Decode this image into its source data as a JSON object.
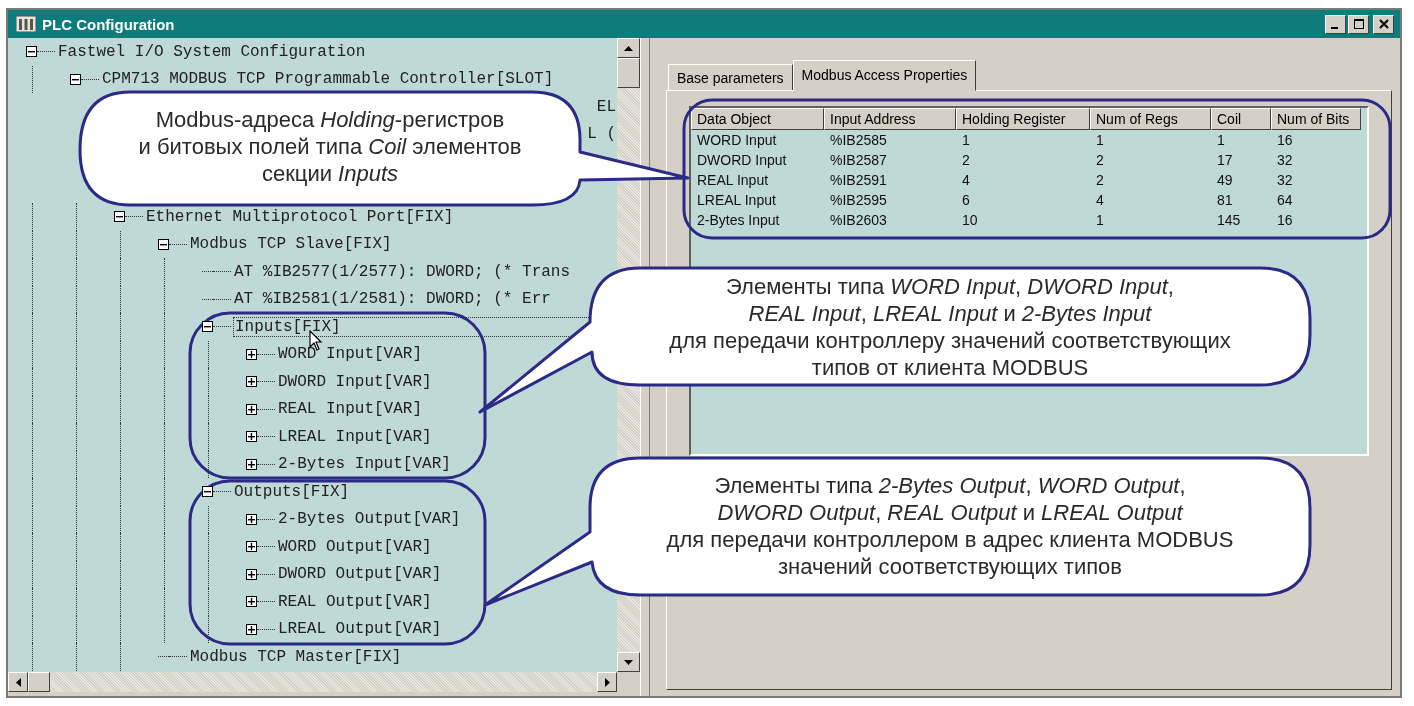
{
  "window": {
    "title": "PLC Configuration"
  },
  "tree": [
    {
      "label": "Fastwel I/O System Configuration",
      "expanded": true,
      "selected": false,
      "children": [
        {
          "label": "CPM713 MODBUS TCP Programmable Controller[SLOT]",
          "expanded": true,
          "selected": false,
          "children": [
            {
              "kind": "covered",
              "fragments": [
                "EL",
                "L ("
              ]
            },
            {
              "label": "Ethernet Multiprotocol Port[FIX]",
              "expanded": true,
              "selected": false,
              "children": [
                {
                  "label": "Modbus TCP Slave[FIX]",
                  "expanded": true,
                  "selected": false,
                  "children": [
                    {
                      "label": "AT %IB2577(1/2577): DWORD; (* Trans",
                      "selected": false
                    },
                    {
                      "label": "AT %IB2581(1/2581): DWORD; (* Err",
                      "selected": false
                    },
                    {
                      "label": "Inputs[FIX]",
                      "expanded": true,
                      "selected": true,
                      "children": [
                        {
                          "label": "WORD Input[VAR]",
                          "expanded": false,
                          "selected": false
                        },
                        {
                          "label": "DWORD Input[VAR]",
                          "expanded": false,
                          "selected": false
                        },
                        {
                          "label": "REAL Input[VAR]",
                          "expanded": false,
                          "selected": false
                        },
                        {
                          "label": "LREAL Input[VAR]",
                          "expanded": false,
                          "selected": false
                        },
                        {
                          "label": "2-Bytes Input[VAR]",
                          "expanded": false,
                          "selected": false
                        }
                      ]
                    },
                    {
                      "label": "Outputs[FIX]",
                      "expanded": true,
                      "selected": false,
                      "children": [
                        {
                          "label": "2-Bytes Output[VAR]",
                          "expanded": false,
                          "selected": false
                        },
                        {
                          "label": "WORD Output[VAR]",
                          "expanded": false,
                          "selected": false
                        },
                        {
                          "label": "DWORD Output[VAR]",
                          "expanded": false,
                          "selected": false
                        },
                        {
                          "label": "REAL Output[VAR]",
                          "expanded": false,
                          "selected": false
                        },
                        {
                          "label": "LREAL Output[VAR]",
                          "expanded": false,
                          "selected": false
                        }
                      ]
                    }
                  ]
                },
                {
                  "label": "Modbus TCP Master[FIX]",
                  "selected": false
                }
              ]
            }
          ]
        }
      ]
    }
  ],
  "tabs": [
    {
      "label": "Base parameters",
      "selected": false
    },
    {
      "label": "Modbus Access Properties",
      "selected": true
    }
  ],
  "table": {
    "columns": [
      "Data Object",
      "Input Address",
      "Holding Register",
      "Num of Regs",
      "Coil",
      "Num of Bits"
    ],
    "rows": [
      [
        "WORD Input",
        "%IB2585",
        "1",
        "1",
        "1",
        "16"
      ],
      [
        "DWORD Input",
        "%IB2587",
        "2",
        "2",
        "17",
        "32"
      ],
      [
        "REAL Input",
        "%IB2591",
        "4",
        "2",
        "49",
        "32"
      ],
      [
        "LREAL Input",
        "%IB2595",
        "6",
        "4",
        "81",
        "64"
      ],
      [
        "2-Bytes Input",
        "%IB2603",
        "10",
        "1",
        "145",
        "16"
      ]
    ]
  },
  "callouts": [
    {
      "text": "Modbus-адреса *Holding*-регистров\nи битовых полей типа *Coil* элементов\nсекции *Inputs*"
    },
    {
      "text": "Элементы типа *WORD Input*, *DWORD Input*,\n*REAL Input*, *LREAL Input* и *2-Bytes Input*\nдля передачи контроллеру значений соответствующих\nтипов от клиента MODBUS"
    },
    {
      "text": "Элементы типа *2-Bytes Output*, *WORD Output*,\n*DWORD Output*, *REAL Output* и *LREAL Output*\nдля передачи контроллером в адрес клиента MODBUS\nзначений соответствующих типов"
    }
  ]
}
